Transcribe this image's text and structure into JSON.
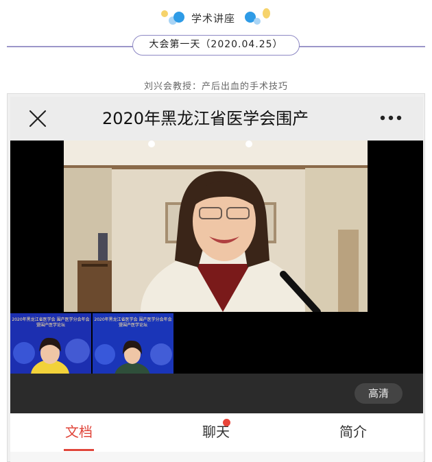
{
  "header": {
    "title": "学术讲座",
    "date_label": "大会第一天（2020.04.25）",
    "subtitle": "刘兴会教授：产后出血的手术技巧"
  },
  "topbar": {
    "title": "2020年黑龙江省医学会围产",
    "close_icon": "close-icon",
    "more_icon": "more-icon"
  },
  "video": {
    "thumbnails": [
      {
        "caption": "2020年黑龙江省医学会 围产医学分会年会暨围产医学论坛"
      },
      {
        "caption": "2020年黑龙江省医学会 围产医学分会年会暨围产医学论坛"
      }
    ],
    "quality_label": "高清"
  },
  "tabs": [
    {
      "label": "文档",
      "active": true
    },
    {
      "label": "聊天",
      "badge": true
    },
    {
      "label": "简介"
    }
  ],
  "colors": {
    "accent": "#e0453a",
    "pill_border": "#8d88c4",
    "dot_yellow": "#f6d36b",
    "dot_blue": "#2e9be6"
  }
}
